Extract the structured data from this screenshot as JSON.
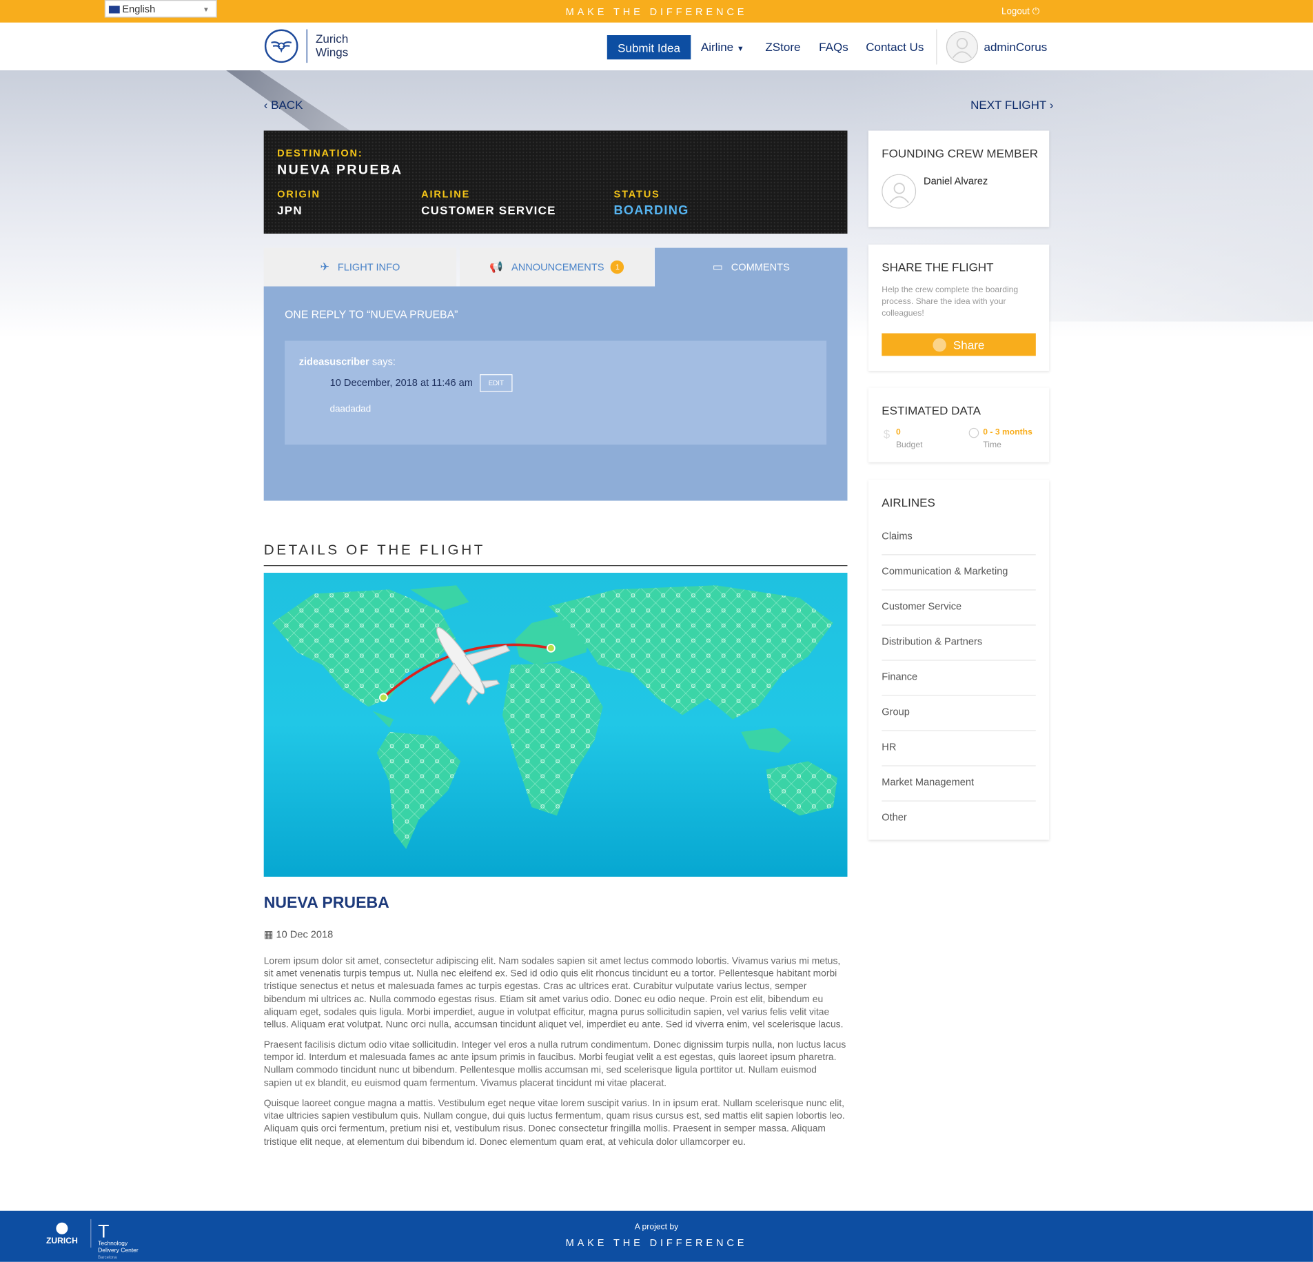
{
  "topbar": {
    "language": "English",
    "tagline": "MAKE THE DIFFERENCE",
    "logout": "Logout"
  },
  "header": {
    "logo_line1": "Zurich",
    "logo_line2": "Wings",
    "nav": {
      "submit": "Submit Idea",
      "airline": "Airline",
      "zstore": "ZStore",
      "faqs": "FAQs",
      "contact": "Contact Us"
    },
    "user": "adminCorus"
  },
  "nav_links": {
    "back": "BACK",
    "next": "NEXT FLIGHT"
  },
  "board": {
    "destination_label": "DESTINATION:",
    "destination": "NUEVA PRUEBA",
    "origin_label": "ORIGIN",
    "origin": "JPN",
    "airline_label": "AIRLINE",
    "airline": "CUSTOMER SERVICE",
    "status_label": "STATUS",
    "status": "BOARDING",
    "status_color": "#56b4f0"
  },
  "tabs": {
    "flight_info": "FLIGHT INFO",
    "announcements": "ANNOUNCEMENTS",
    "announcements_count": "1",
    "comments": "COMMENTS"
  },
  "comments": {
    "title": "ONE REPLY TO “NUEVA PRUEBA”",
    "author": "zideasuscriber",
    "says": "says:",
    "date": "10 December, 2018 at 11:46 am",
    "edit": "EDIT",
    "text": "daadadad"
  },
  "details": {
    "heading": "DETAILS OF THE FLIGHT",
    "title": "NUEVA PRUEBA",
    "date": "10 Dec 2018",
    "paragraphs": [
      "Lorem ipsum dolor sit amet, consectetur adipiscing elit. Nam sodales sapien sit amet lectus commodo lobortis. Vivamus varius mi metus, sit amet venenatis turpis tempus ut. Nulla nec eleifend ex. Sed id odio quis elit rhoncus tincidunt eu a tortor. Pellentesque habitant morbi tristique senectus et netus et malesuada fames ac turpis egestas. Cras ac ultrices erat. Curabitur vulputate varius lectus, semper bibendum mi ultrices ac. Nulla commodo egestas risus. Etiam sit amet varius odio. Donec eu odio neque. Proin est elit, bibendum eu aliquam eget, sodales quis ligula. Morbi imperdiet, augue in volutpat efficitur, magna purus sollicitudin sapien, vel varius felis velit vitae tellus. Aliquam erat volutpat. Nunc orci nulla, accumsan tincidunt aliquet vel, imperdiet eu ante. Sed id viverra enim, vel scelerisque lacus.",
      "Praesent facilisis dictum odio vitae sollicitudin. Integer vel eros a nulla rutrum condimentum. Donec dignissim turpis nulla, non luctus lacus tempor id. Interdum et malesuada fames ac ante ipsum primis in faucibus. Morbi feugiat velit a est egestas, quis laoreet ipsum pharetra. Nullam commodo tincidunt nunc ut bibendum. Pellentesque mollis accumsan mi, sed scelerisque ligula porttitor ut. Nullam euismod sapien ut ex blandit, eu euismod quam fermentum. Vivamus placerat tincidunt mi vitae placerat.",
      "Quisque laoreet congue magna a mattis. Vestibulum eget neque vitae lorem suscipit varius. In in ipsum erat. Nullam scelerisque nunc elit, vitae ultricies sapien vestibulum quis. Nullam congue, dui quis luctus fermentum, quam risus cursus est, sed mattis elit sapien lobortis leo. Aliquam quis orci fermentum, pretium nisi et, vestibulum risus. Donec consectetur fringilla mollis. Praesent in semper massa. Aliquam tristique elit neque, at elementum dui bibendum id. Donec elementum quam erat, at vehicula dolor ullamcorper eu."
    ]
  },
  "sidebar": {
    "founding_title": "FOUNDING CREW MEMBER",
    "founding_name": "Daniel Alvarez",
    "share_title": "SHARE THE FLIGHT",
    "share_text": "Help the crew complete the boarding process. Share the idea with your colleagues!",
    "share_button": "Share",
    "estimated_title": "ESTIMATED DATA",
    "budget_value": "0",
    "budget_label": "Budget",
    "time_value": "0 - 3 months",
    "time_label": "Time",
    "airlines_title": "AIRLINES",
    "airlines": [
      "Claims",
      "Communication & Marketing",
      "Customer Service",
      "Distribution & Partners",
      "Finance",
      "Group",
      "HR",
      "Market Management",
      "Other"
    ]
  },
  "footer": {
    "zurich": "ZURICH",
    "tdc_line1": "Technology",
    "tdc_line2": "Delivery Center",
    "tdc_line3": "Barcelona",
    "project": "A project by",
    "tagline": "MAKE THE DIFFERENCE"
  },
  "colors": {
    "accent": "#f8ad1c",
    "primary": "#0d4ea2",
    "navy": "#0e2c6b"
  }
}
